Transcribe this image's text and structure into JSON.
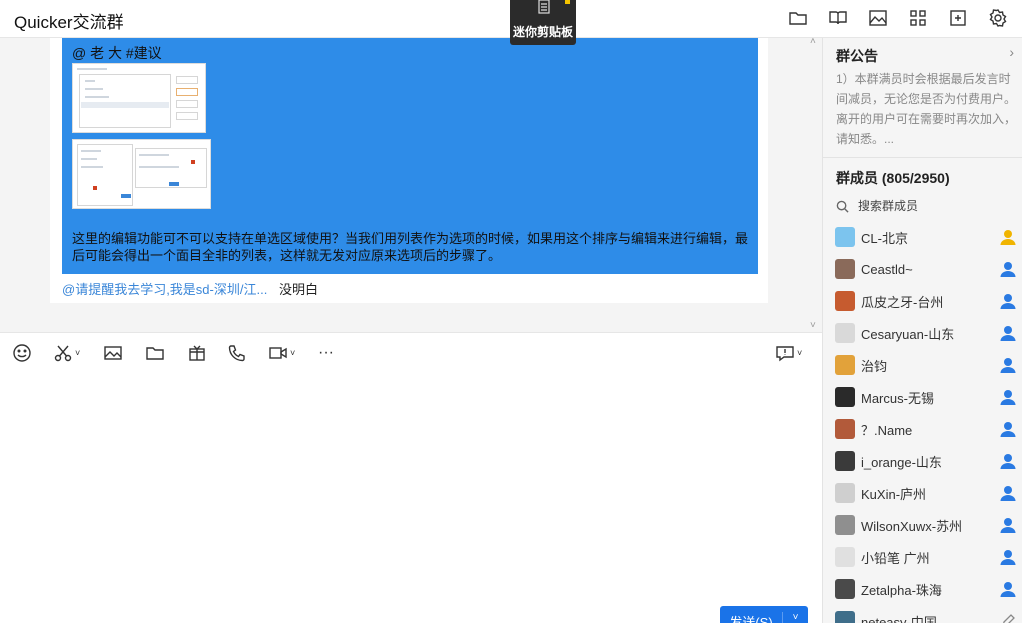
{
  "header": {
    "title": "Quicker交流群",
    "icons": [
      "folder-icon",
      "book-icon",
      "image-icon",
      "apps-grid-icon",
      "add-window-icon",
      "gear-icon"
    ]
  },
  "tooltip": {
    "label": "迷你剪贴板"
  },
  "message": {
    "mention": "@ 老 大 #建议",
    "body": "这里的编辑功能可不可以支持在单选区域使用？当我们用列表作为选项的时候，如果用这个排序与编辑来进行编辑，最后可能会得出一个面目全非的列表，这样就无发对应原来选项后的步骤了。",
    "reply_link": "@请提醒我去学习,我是sd-深圳/江...",
    "reply_name": "没明白"
  },
  "toolbar": {
    "icons": [
      "emoji-icon",
      "scissors-icon",
      "image-icon",
      "folder-icon",
      "gift-icon",
      "phone-icon",
      "video-icon",
      "more-icon",
      "chat-bubble-icon"
    ],
    "more_label": "···"
  },
  "send": {
    "label": "发送(S)"
  },
  "sidebar": {
    "notice_title": "群公告",
    "notice_text": "1）本群满员时会根据最后发言时间减员，无论您是否为付费用户。离开的用户可在需要时再次加入，请知悉。...",
    "members_title": "群成员 (805/2950)",
    "search_placeholder": "搜索群成员",
    "members": [
      {
        "name": "CL-北京",
        "role": "owner",
        "avatar_color": "#7cc4ee"
      },
      {
        "name": "Ceastld~",
        "role": "admin",
        "avatar_color": "#8a6a5a"
      },
      {
        "name": "瓜皮之牙-台州",
        "role": "admin",
        "avatar_color": "#c65b2f"
      },
      {
        "name": "Cesaryuan-山东",
        "role": "admin",
        "avatar_color": "#d9d9d9"
      },
      {
        "name": "治钧",
        "role": "admin",
        "avatar_color": "#e2a23a"
      },
      {
        "name": "Marcus-无锡",
        "role": "admin",
        "avatar_color": "#2a2a2a"
      },
      {
        "name": "？.Name",
        "role": "admin",
        "avatar_color": "#b25a3a"
      },
      {
        "name": "i_orange-山东",
        "role": "admin",
        "avatar_color": "#3a3a3a"
      },
      {
        "name": "KuXin-庐州",
        "role": "admin",
        "avatar_color": "#cfcfcf"
      },
      {
        "name": "WilsonXuwx-苏州",
        "role": "admin",
        "avatar_color": "#8f8f8f"
      },
      {
        "name": "小铅笔 广州",
        "role": "admin",
        "avatar_color": "#e0e0e0"
      },
      {
        "name": "Zetalpha-珠海",
        "role": "admin",
        "avatar_color": "#4a4a4a"
      },
      {
        "name": "neteasy-中国",
        "role": "edit",
        "avatar_color": "#3f6e8a"
      }
    ]
  },
  "colors": {
    "accent": "#1a73e8",
    "bubble": "#2e8ce8",
    "owner": "#f0b400",
    "admin": "#2a7ae2"
  }
}
